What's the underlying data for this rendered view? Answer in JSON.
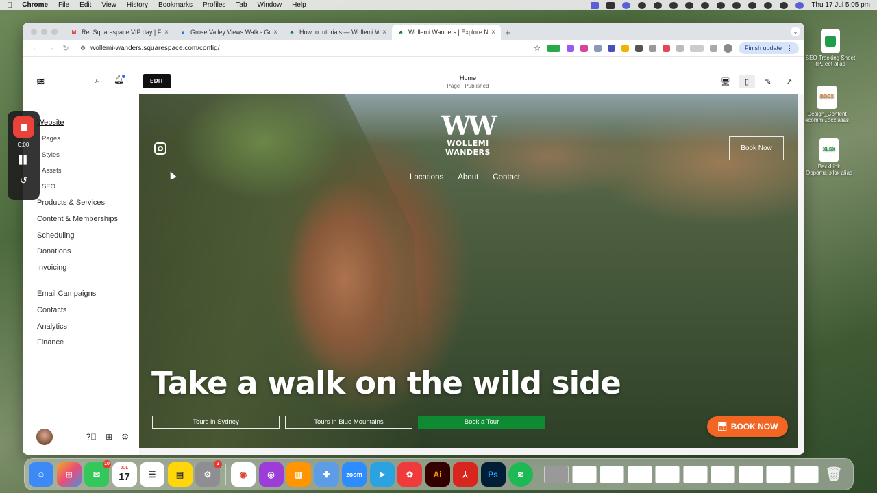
{
  "menubar": {
    "app": "Chrome",
    "items": [
      "File",
      "Edit",
      "View",
      "History",
      "Bookmarks",
      "Profiles",
      "Tab",
      "Window",
      "Help"
    ],
    "clock": "Thu 17 Jul  5:05 pm"
  },
  "desktop": {
    "icons": [
      {
        "label": "SEO Tracking Sheet (P...eet alias",
        "kind": "sheet"
      },
      {
        "label": "Design_Content ecomm...ocx alias",
        "kind": "docx",
        "badge": "DOCX"
      },
      {
        "label": "BackLink Opportu...xlsx alias",
        "kind": "xlsx",
        "badge": "XLSX"
      }
    ]
  },
  "browser": {
    "tabs": [
      {
        "title": "Re: Squarespace VIP day | Fe",
        "favicon": "gmail-icon",
        "color": "#d93025"
      },
      {
        "title": "Grose Valley Views Walk - Go",
        "favicon": "drive-icon",
        "color": "#1a73e8"
      },
      {
        "title": "How to tutorials — Wollemi W",
        "favicon": "ww-icon",
        "color": "#1e7b3a"
      },
      {
        "title": "Wollemi Wanders | Explore Na",
        "favicon": "ww-icon",
        "color": "#1e7b3a",
        "active": true
      }
    ],
    "url": "wollemi-wanders.squarespace.com/config/",
    "finish_update": "Finish update"
  },
  "sidebar": {
    "website": "Website",
    "sub_items": [
      "Pages",
      "Styles",
      "Assets",
      "SEO"
    ],
    "items": [
      "Products & Services",
      "Content & Memberships",
      "Scheduling",
      "Donations",
      "Invoicing"
    ],
    "items2": [
      "Email Campaigns",
      "Contacts",
      "Analytics",
      "Finance"
    ]
  },
  "editor": {
    "edit_label": "EDIT",
    "page_title": "Home",
    "page_status": "Page · Published"
  },
  "site": {
    "brand_mark": "WW",
    "brand_name": "WOLLEMI WANDERS",
    "nav": [
      "Locations",
      "About",
      "Contact"
    ],
    "header_button": "Book  Now",
    "hero_title": "Take a walk on the wild side",
    "ctas": [
      "Tours in Sydney",
      "Tours in Blue Mountains",
      "Book a Tour"
    ],
    "fab_label": "BOOK NOW",
    "accent_green": "#0e8a33",
    "accent_orange": "#f26522"
  },
  "recorder": {
    "time": "0:00"
  },
  "dock": {
    "messages_badge": "10",
    "calendar_month": "JUL",
    "calendar_day": "17",
    "settings_badge": "2",
    "zoom_label": "zoom",
    "ai_label": "Ai",
    "ps_label": "Ps"
  }
}
